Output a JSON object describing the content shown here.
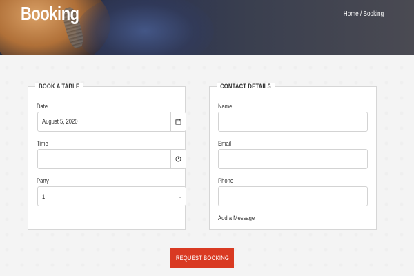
{
  "header": {
    "title": "Booking",
    "breadcrumb": "Home / Booking"
  },
  "book_table": {
    "legend": "BOOK A TABLE",
    "date_label": "Date",
    "date_value": "August 5, 2020",
    "time_label": "Time",
    "time_value": "",
    "party_label": "Party",
    "party_value": "1",
    "icons": {
      "date": "calendar-icon",
      "time": "clock-icon",
      "party": "chevron-down-icon"
    }
  },
  "contact": {
    "legend": "CONTACT DETAILS",
    "name_label": "Name",
    "email_label": "Email",
    "phone_label": "Phone",
    "message_label": "Add a Message"
  },
  "submit": {
    "label": "REQUEST BOOKING",
    "color": "#d93a22"
  }
}
